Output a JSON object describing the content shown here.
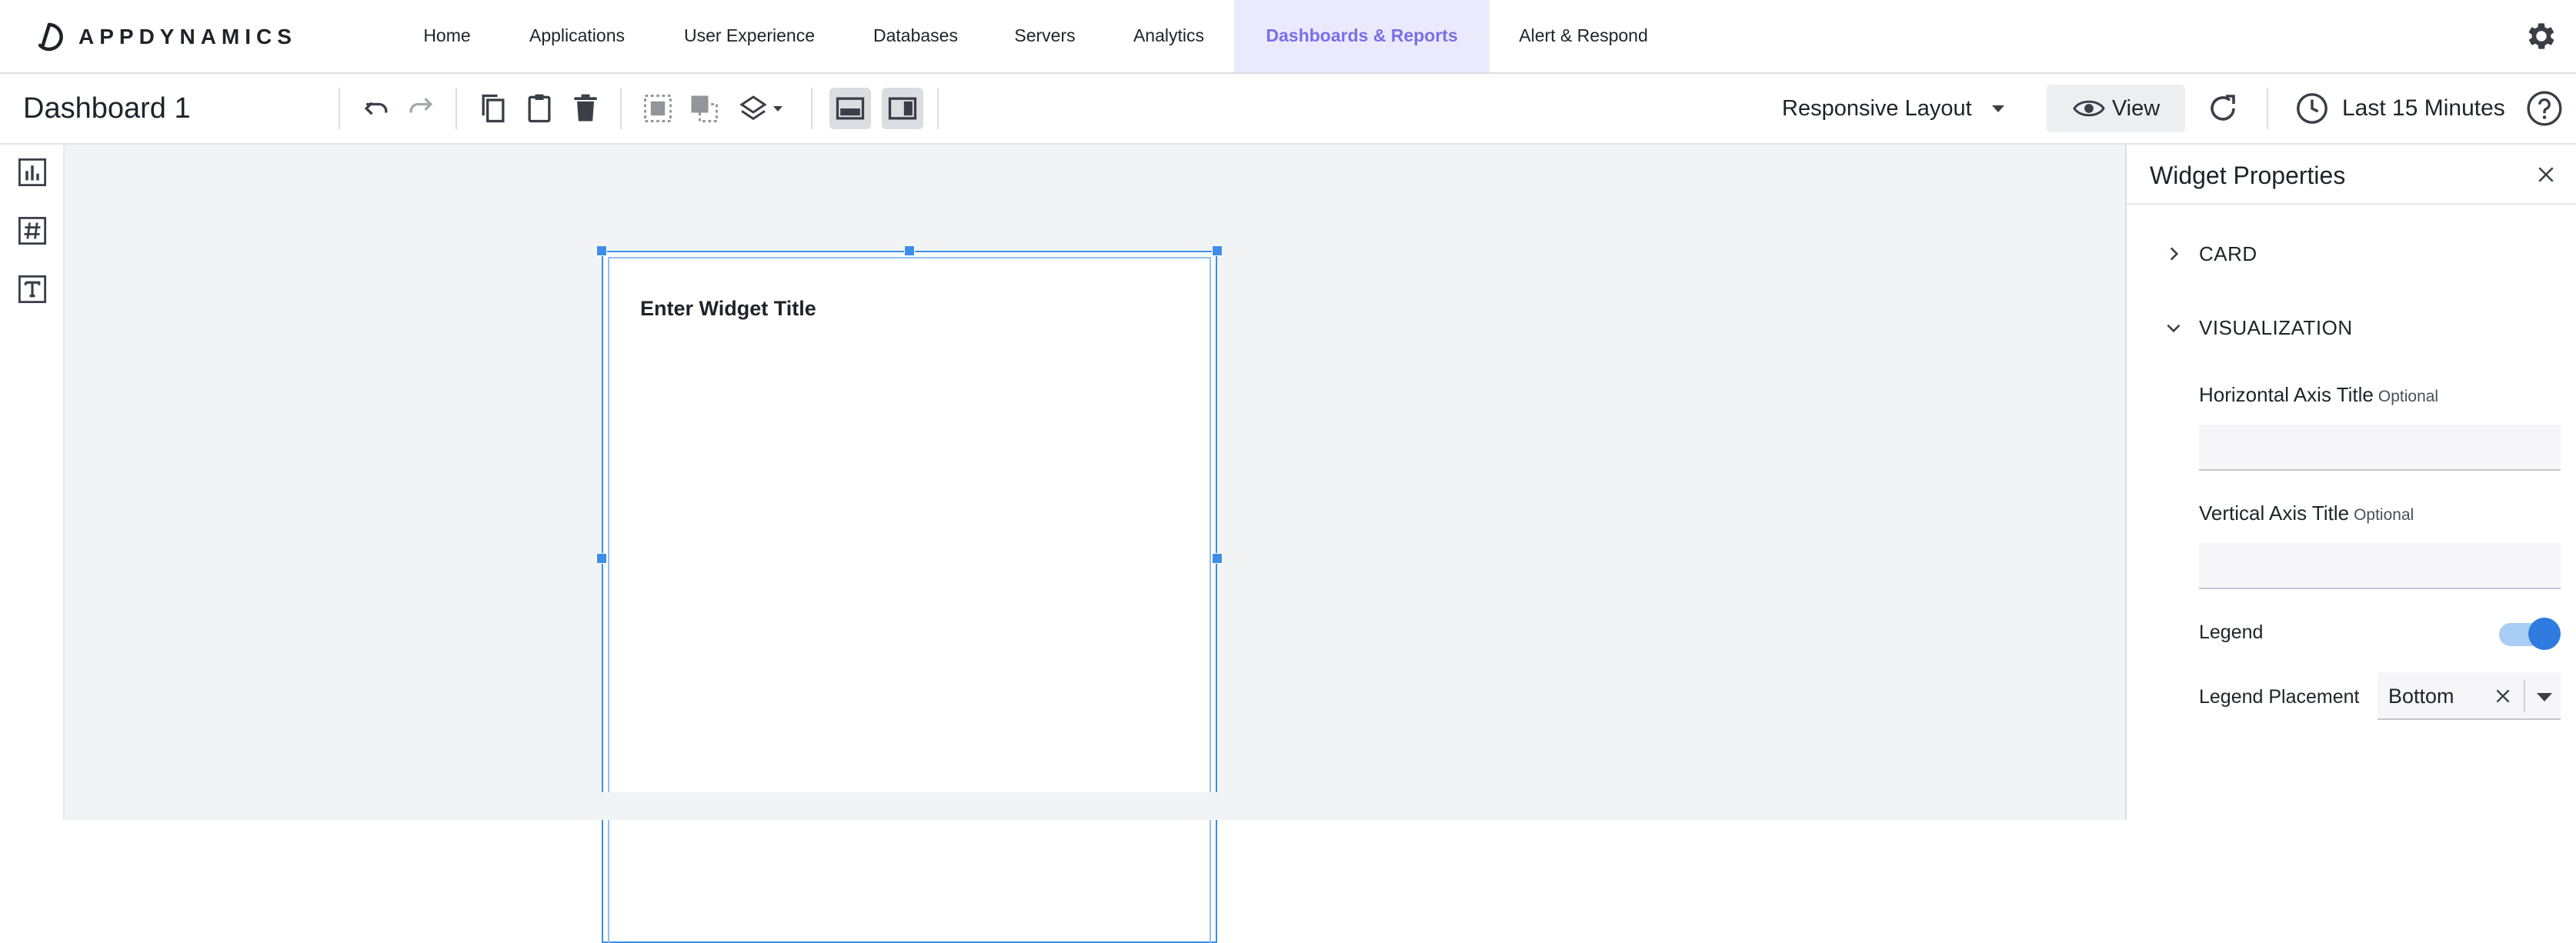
{
  "brand": {
    "name": "APPDYNAMICS"
  },
  "nav": {
    "items": [
      {
        "label": "Home"
      },
      {
        "label": "Applications"
      },
      {
        "label": "User Experience"
      },
      {
        "label": "Databases"
      },
      {
        "label": "Servers"
      },
      {
        "label": "Analytics"
      },
      {
        "label": "Dashboards & Reports",
        "active": true
      },
      {
        "label": "Alert & Respond"
      }
    ],
    "settings_icon": "gear-icon"
  },
  "toolbar": {
    "dashboard_title": "Dashboard 1",
    "layout_mode": "Responsive Layout",
    "view_label": "View",
    "time_range": "Last 15 Minutes",
    "icons": [
      "undo-icon",
      "redo-icon",
      "copy-icon",
      "paste-icon",
      "delete-icon",
      "bring-forward-icon",
      "send-backward-icon",
      "layers-icon",
      "bottom-panel-icon",
      "side-panel-icon",
      "refresh-icon",
      "clock-icon",
      "help-icon"
    ]
  },
  "left_rail": {
    "icons": [
      "chart-widget-icon",
      "metric-number-widget-icon",
      "text-widget-icon"
    ]
  },
  "widget": {
    "title_placeholder": "Enter Widget Title"
  },
  "panel": {
    "title": "Widget Properties",
    "sections": {
      "card": {
        "label": "CARD",
        "expanded": false
      },
      "visualization": {
        "label": "VISUALIZATION",
        "expanded": true
      }
    },
    "horizontal_axis": {
      "label": "Horizontal Axis Title",
      "optional": "Optional",
      "value": ""
    },
    "vertical_axis": {
      "label": "Vertical Axis Title",
      "optional": "Optional",
      "value": ""
    },
    "legend": {
      "label": "Legend",
      "enabled": true
    },
    "legend_placement": {
      "label": "Legend Placement",
      "value": "Bottom"
    }
  },
  "colors": {
    "accent": "#7b6ee8",
    "active_nav_bg": "#ebeafc",
    "selection": "#3d8ee8",
    "toggle_on": "#2f7be0",
    "canvas_bg": "#f2f3f5"
  }
}
